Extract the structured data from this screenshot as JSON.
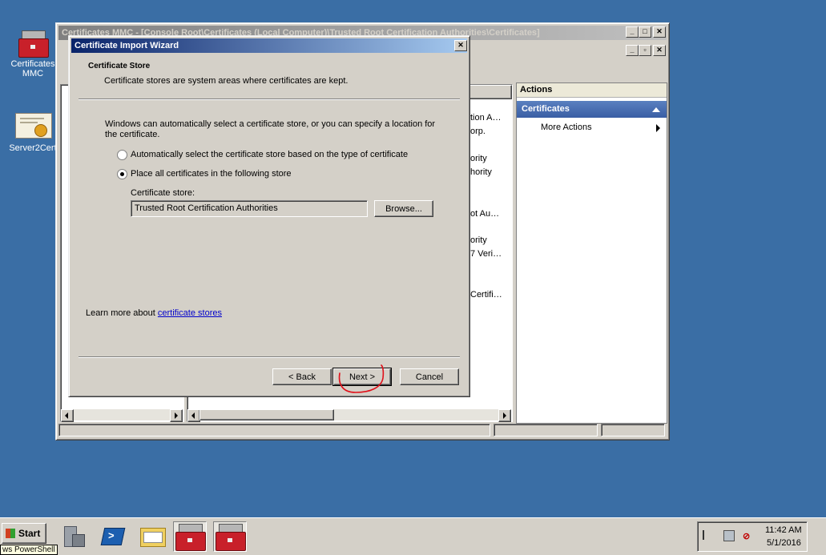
{
  "desktop": {
    "icons": [
      {
        "label_line1": "Certificates",
        "label_line2": "MMC"
      },
      {
        "label_line1": "Server2Cert",
        "label_line2": ""
      }
    ]
  },
  "mmc": {
    "title": "Certificates MMC - [Console Root\\Certificates (Local Computer)\\Trusted Root Certification Authorities\\Certificates]",
    "list_fragments": [
      "tion A…",
      "orp.",
      "ority",
      "hority",
      "ot Au…",
      "ority",
      "7 Veri…",
      "Certifi…"
    ],
    "actions": {
      "header": "Actions",
      "section": "Certificates",
      "items": [
        "More Actions"
      ]
    }
  },
  "wizard": {
    "title": "Certificate Import Wizard",
    "heading": "Certificate Store",
    "subheading": "Certificate stores are system areas where certificates are kept.",
    "intro": "Windows can automatically select a certificate store, or you can specify a location for the certificate.",
    "option_auto": "Automatically select the certificate store based on the type of certificate",
    "option_manual": "Place all certificates in the following store",
    "selected_option": "manual",
    "store_label": "Certificate store:",
    "store_value": "Trusted Root Certification Authorities",
    "browse_label": "Browse...",
    "learn_more_prefix": "Learn more about ",
    "learn_more_link": "certificate stores",
    "back_label": "< Back",
    "next_label": "Next >",
    "cancel_label": "Cancel"
  },
  "taskbar": {
    "start_label": "Start",
    "tooltip": "ws PowerShell",
    "time": "11:42 AM",
    "date": "5/1/2016"
  },
  "icons": {
    "close": "close-icon",
    "minimize": "minimize-icon",
    "maximize": "maximize-icon",
    "restore": "restore-icon",
    "collapse": "chevron-up-icon",
    "submenu": "chevron-right-icon"
  },
  "colors": {
    "desktop": "#3a6ea5",
    "active_caption": "#0a246a",
    "actions_header": "#4a6fb4",
    "annotation": "#e0101a"
  }
}
